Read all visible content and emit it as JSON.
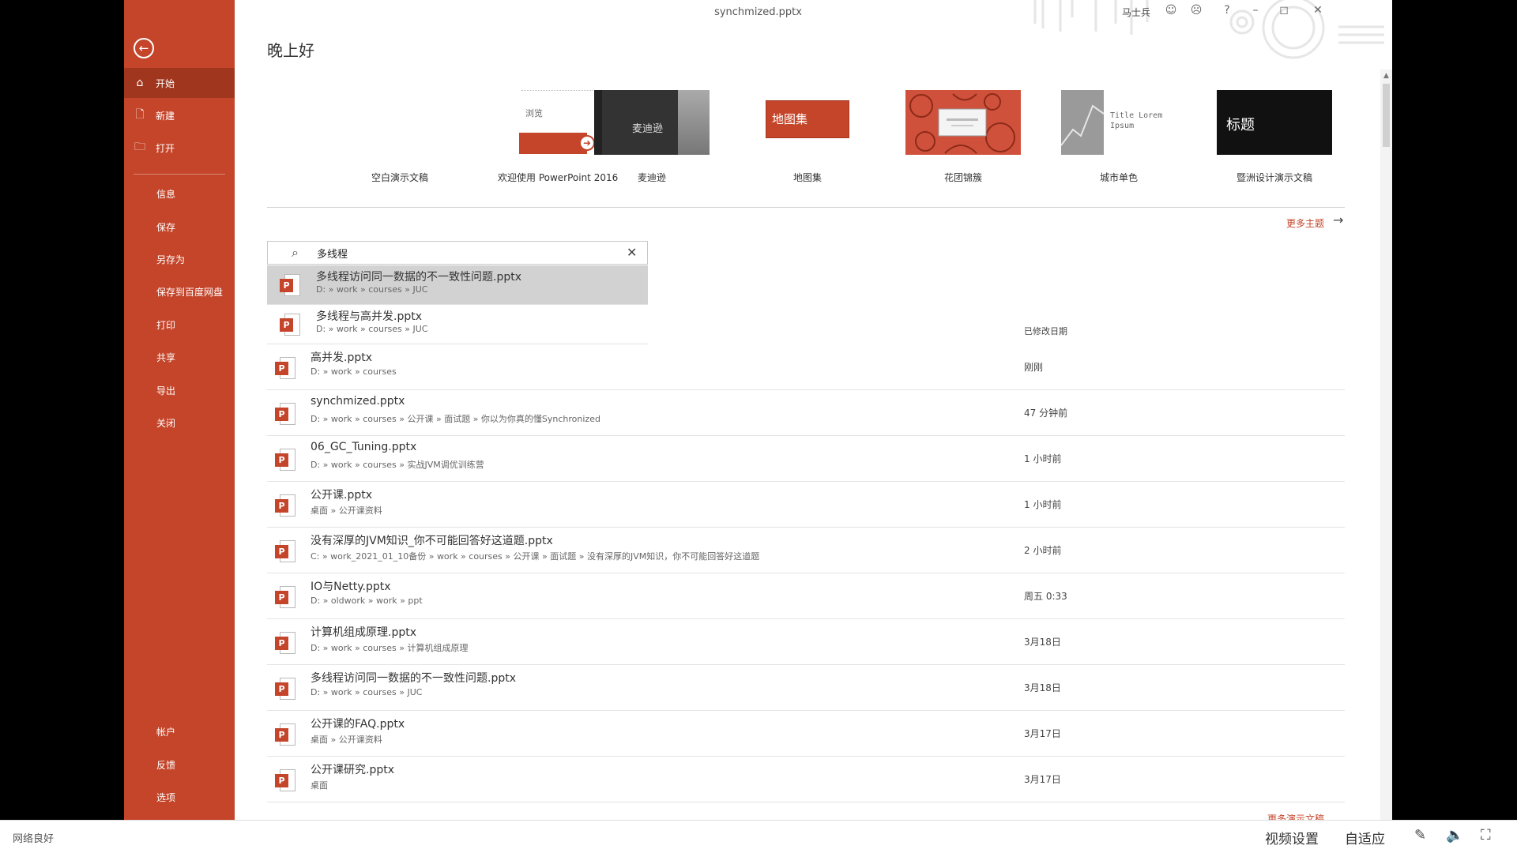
{
  "window": {
    "title": "synchmized.pptx",
    "user": "马士兵"
  },
  "titlebar_icons": [
    "smile-icon",
    "frown-icon",
    "help-icon",
    "minimize-icon",
    "restore-icon",
    "close-icon"
  ],
  "sidebar": {
    "back_icon": "←",
    "items": [
      {
        "label": "开始",
        "icon": "⌂",
        "active": true
      },
      {
        "label": "新建",
        "icon": "🗋"
      },
      {
        "label": "打开",
        "icon": "🗀"
      },
      {
        "label": "信息"
      },
      {
        "label": "保存"
      },
      {
        "label": "另存为"
      },
      {
        "label": "保存到百度网盘"
      },
      {
        "label": "打印"
      },
      {
        "label": "共享"
      },
      {
        "label": "导出"
      },
      {
        "label": "关闭"
      },
      {
        "label": "帐户"
      },
      {
        "label": "反馈"
      },
      {
        "label": "选项"
      }
    ]
  },
  "greeting": "晚上好",
  "templates": [
    {
      "label": "空白演示文稿"
    },
    {
      "label": "欢迎使用 PowerPoint 2016",
      "thumb_text": "浏览"
    },
    {
      "label": "麦迪逊",
      "thumb_text": "麦迪逊"
    },
    {
      "label": "地图集",
      "thumb_text": "地图集"
    },
    {
      "label": "花团锦簇"
    },
    {
      "label": "城市单色",
      "thumb_text": "Title Lorem Ipsum"
    },
    {
      "label": "暨洲设计演示文稿",
      "thumb_text": "标题"
    }
  ],
  "more_themes": "更多主题",
  "search": {
    "query": "多线程",
    "placeholder": ""
  },
  "search_results": [
    {
      "name": "多线程访问同一数据的不一致性问题.pptx",
      "path": "D: » work » courses » JUC",
      "selected": true
    },
    {
      "name": "多线程与高并发.pptx",
      "path": "D: » work » courses » JUC"
    }
  ],
  "column_header": "已修改日期",
  "recent_files": [
    {
      "name": "高并发.pptx",
      "path": "D: » work » courses",
      "date": "刚刚"
    },
    {
      "name": "synchmized.pptx",
      "path": "D: » work » courses » 公开课 » 面试题 » 你以为你真的懂Synchronized",
      "date": "47 分钟前"
    },
    {
      "name": "06_GC_Tuning.pptx",
      "path": "D: » work » courses » 实战JVM调优训练营",
      "date": "1 小时前"
    },
    {
      "name": "公开课.pptx",
      "path": "桌面 » 公开课资料",
      "date": "1 小时前"
    },
    {
      "name": "没有深厚的JVM知识_你不可能回答好这道题.pptx",
      "path": "C: » work_2021_01_10备份 » work » courses » 公开课 » 面试题 » 没有深厚的JVM知识，你不可能回答好这道题",
      "date": "2 小时前"
    },
    {
      "name": "IO与Netty.pptx",
      "path": "D: » oldwork » work » ppt",
      "date": "周五 0:33"
    },
    {
      "name": "计算机组成原理.pptx",
      "path": "D: » work » courses » 计算机组成原理",
      "date": "3月18日"
    },
    {
      "name": "多线程访问同一数据的不一致性问题.pptx",
      "path": "D: » work » courses » JUC",
      "date": "3月18日"
    },
    {
      "name": "公开课的FAQ.pptx",
      "path": "桌面 » 公开课资料",
      "date": "3月17日"
    },
    {
      "name": "公开课研究.pptx",
      "path": "桌面",
      "date": "3月17日"
    }
  ],
  "more_docs": "更多演示文稿",
  "player": {
    "network": "网络良好",
    "video_settings": "视频设置",
    "fit": "自适应"
  },
  "colors": {
    "accent": "#c4452a",
    "accent_dark": "#a1361e"
  }
}
